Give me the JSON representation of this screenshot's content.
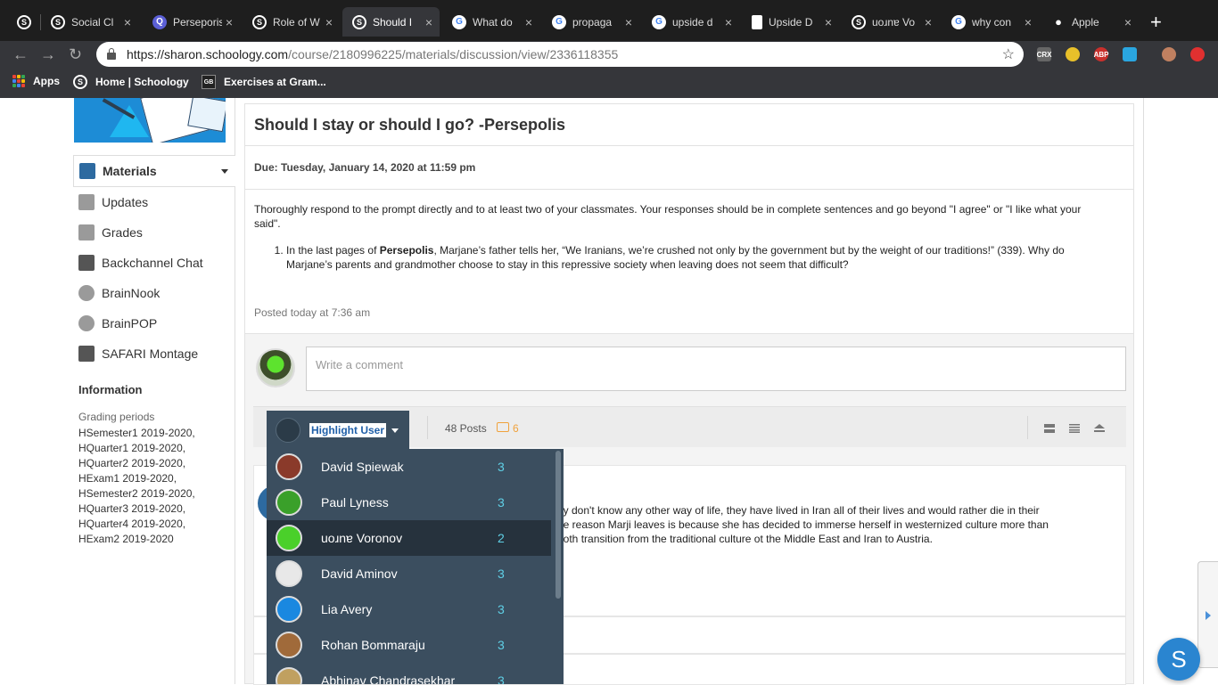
{
  "browser": {
    "tabs": [
      {
        "title": "",
        "icon": "s"
      },
      {
        "title": "Social Cl",
        "icon": "s"
      },
      {
        "title": "Perseporis",
        "icon": "q"
      },
      {
        "title": "Role of W",
        "icon": "s"
      },
      {
        "title": "Should I",
        "icon": "s"
      },
      {
        "title": "What do",
        "icon": "g"
      },
      {
        "title": "propaga",
        "icon": "g"
      },
      {
        "title": "upside d",
        "icon": "g"
      },
      {
        "title": "Upside D",
        "icon": "doc"
      },
      {
        "title": "uoɹnɐ Vo",
        "icon": "s"
      },
      {
        "title": "why con",
        "icon": "g"
      },
      {
        "title": "Apple",
        "icon": "apple"
      }
    ],
    "url_host": "https://sharon.schoology.com",
    "url_path": "/course/2180996225/materials/discussion/view/2336118355",
    "bookmarks": {
      "apps": "Apps",
      "home": "Home | Schoology",
      "exercises": "Exercises at Gram...",
      "gb_icon": "GB"
    },
    "extensions": [
      "CRX",
      "ABP"
    ]
  },
  "sidebar": {
    "items": [
      {
        "label": "Materials",
        "icon": "materials-icon",
        "color": "#2d6aa0"
      },
      {
        "label": "Updates",
        "icon": "updates-icon",
        "color": "#9a9a9a"
      },
      {
        "label": "Grades",
        "icon": "grades-icon",
        "color": "#9a9a9a"
      },
      {
        "label": "Backchannel Chat",
        "icon": "chat-icon",
        "color": "#555"
      },
      {
        "label": "BrainNook",
        "icon": "brainnook-icon",
        "color": "#9a9a9a"
      },
      {
        "label": "BrainPOP",
        "icon": "brainpop-icon",
        "color": "#9a9a9a"
      },
      {
        "label": "SAFARI Montage",
        "icon": "safari-icon",
        "color": "#555"
      }
    ],
    "info_heading": "Information",
    "grading_heading": "Grading periods",
    "grading_periods": "HSemester1 2019-2020,\nHQuarter1 2019-2020,\nHQuarter2 2019-2020,\nHExam1 2019-2020,\nHSemester2 2019-2020,\nHQuarter3 2019-2020,\nHQuarter4 2019-2020,\nHExam2 2019-2020"
  },
  "discussion": {
    "title": "Should I stay or should I go? -Persepolis",
    "due": "Due: Tuesday, January 14, 2020 at 11:59 pm",
    "instructions": "Thoroughly respond to the prompt directly and to at least two of your classmates. Your responses should be in complete sentences and go beyond \"I agree\" or \"I like what your said\".",
    "question_pre": "In the last pages of ",
    "question_bold": "Persepolis",
    "question_post": ", Marjane’s father tells her, “We Iranians, we’re crushed not only by the government but by the weight of our traditions!” (339). Why do Marjane’s parents and grandmother choose to stay in this repressive society when leaving does not seem that difficult?",
    "posted": "Posted today at 7:36 am",
    "comment_placeholder": "Write a comment"
  },
  "toolbar": {
    "highlight_label": "Highlight User",
    "posts": "48 Posts",
    "comments_count": "6"
  },
  "post": {
    "text": "ey don't know any other way of life, they have lived in Iran all of their lives and would rather die in their\nhe reason Marji leaves is because she has decided to immerse herself in westernized culture more than\nboth transition from the traditional culture ot the Middle East and Iran to Austria."
  },
  "highlight_users": [
    {
      "name": "David Spiewak",
      "count": "3",
      "avatar_color": "#8a3a2a"
    },
    {
      "name": "Paul Lyness",
      "count": "3",
      "avatar_color": "#3aa02a"
    },
    {
      "name": "uoɹnɐ Voronov",
      "count": "2",
      "avatar_color": "#4ad02a",
      "selected": true
    },
    {
      "name": "David Aminov",
      "count": "3",
      "avatar_color": "#e8e8e8"
    },
    {
      "name": "Lia Avery",
      "count": "3",
      "avatar_color": "#1a88e0"
    },
    {
      "name": "Rohan Bommaraju",
      "count": "3",
      "avatar_color": "#a06a3a"
    },
    {
      "name": "Abhinav Chandrasekhar",
      "count": "3",
      "avatar_color": "#c0a060"
    }
  ],
  "fab_label": "S"
}
